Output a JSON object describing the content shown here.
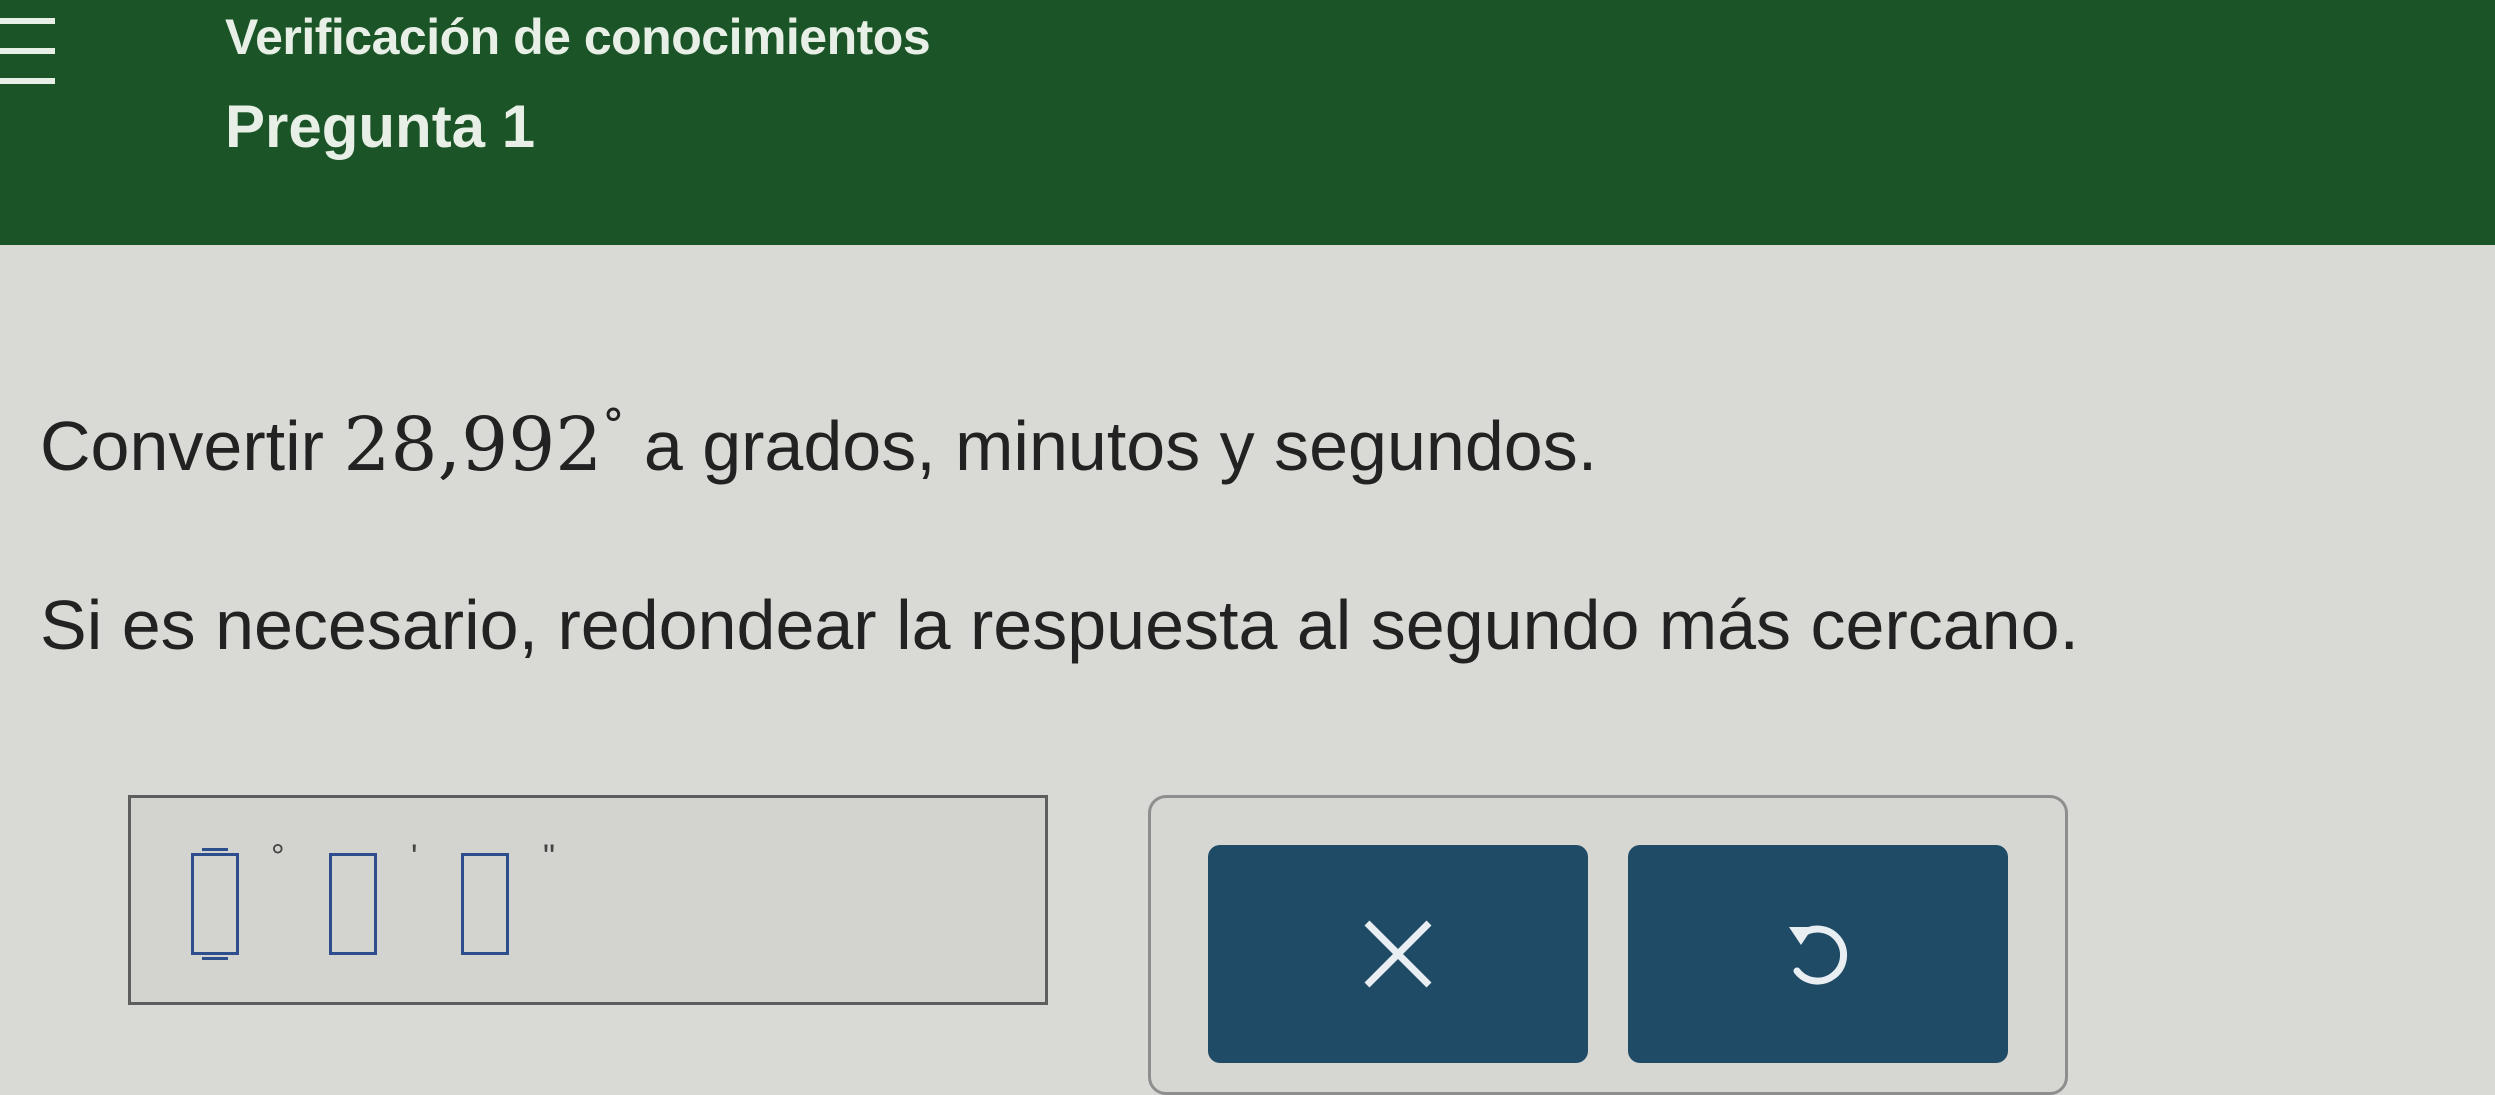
{
  "header": {
    "subtitle": "Verificación de conocimientos",
    "title": "Pregunta 1"
  },
  "question": {
    "prefix": "Convertir",
    "value": "28,992",
    "degree_symbol": "°",
    "suffix": "a grados, minutos y segundos."
  },
  "instruction": "Si es necesario, redondear la respuesta al segundo más cercano.",
  "answer": {
    "degrees_unit": "°",
    "minutes_unit": "'",
    "seconds_unit": "\"",
    "degrees_value": "",
    "minutes_value": "",
    "seconds_value": ""
  },
  "buttons": {
    "clear_icon": "x-icon",
    "undo_icon": "undo-icon"
  },
  "colors": {
    "header_bg": "#1b5527",
    "button_bg": "#1f4b66",
    "input_border": "#2c4e8c"
  }
}
